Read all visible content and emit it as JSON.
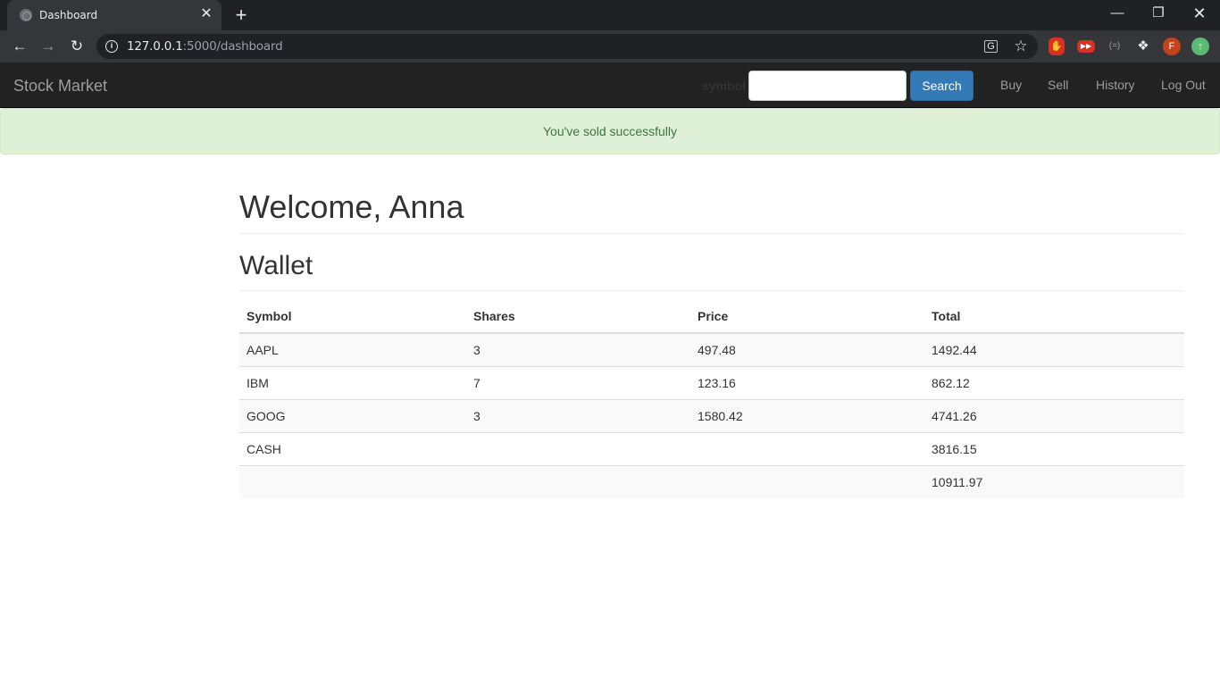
{
  "browser": {
    "tab_title": "Dashboard",
    "tab_close": "✕",
    "new_tab": "+",
    "url_host": "127.0.0.1",
    "url_path": ":5000/dashboard",
    "avatar_letter": "F"
  },
  "navbar": {
    "brand": "Stock Market",
    "symbol_label": "symbol",
    "search_value": "",
    "search_button": "Search",
    "links": {
      "buy": "Buy",
      "sell": "Sell",
      "history": "History",
      "logout": "Log Out"
    }
  },
  "alert": {
    "message": "You've sold successfully",
    "color": "#3c763d",
    "background": "#dff0d8"
  },
  "main": {
    "welcome": "Welcome, Anna",
    "wallet_heading": "Wallet",
    "table": {
      "headers": {
        "symbol": "Symbol",
        "shares": "Shares",
        "price": "Price",
        "total": "Total"
      },
      "rows": [
        {
          "symbol": "AAPL",
          "shares": "3",
          "price": "497.48",
          "total": "1492.44"
        },
        {
          "symbol": "IBM",
          "shares": "7",
          "price": "123.16",
          "total": "862.12"
        },
        {
          "symbol": "GOOG",
          "shares": "3",
          "price": "1580.42",
          "total": "4741.26"
        },
        {
          "symbol": "CASH",
          "shares": "",
          "price": "",
          "total": "3816.15"
        },
        {
          "symbol": "",
          "shares": "",
          "price": "",
          "total": "10911.97"
        }
      ]
    }
  },
  "colors": {
    "navbar": "#222222",
    "primary": "#337ab7",
    "browser_dark": "#202124"
  }
}
